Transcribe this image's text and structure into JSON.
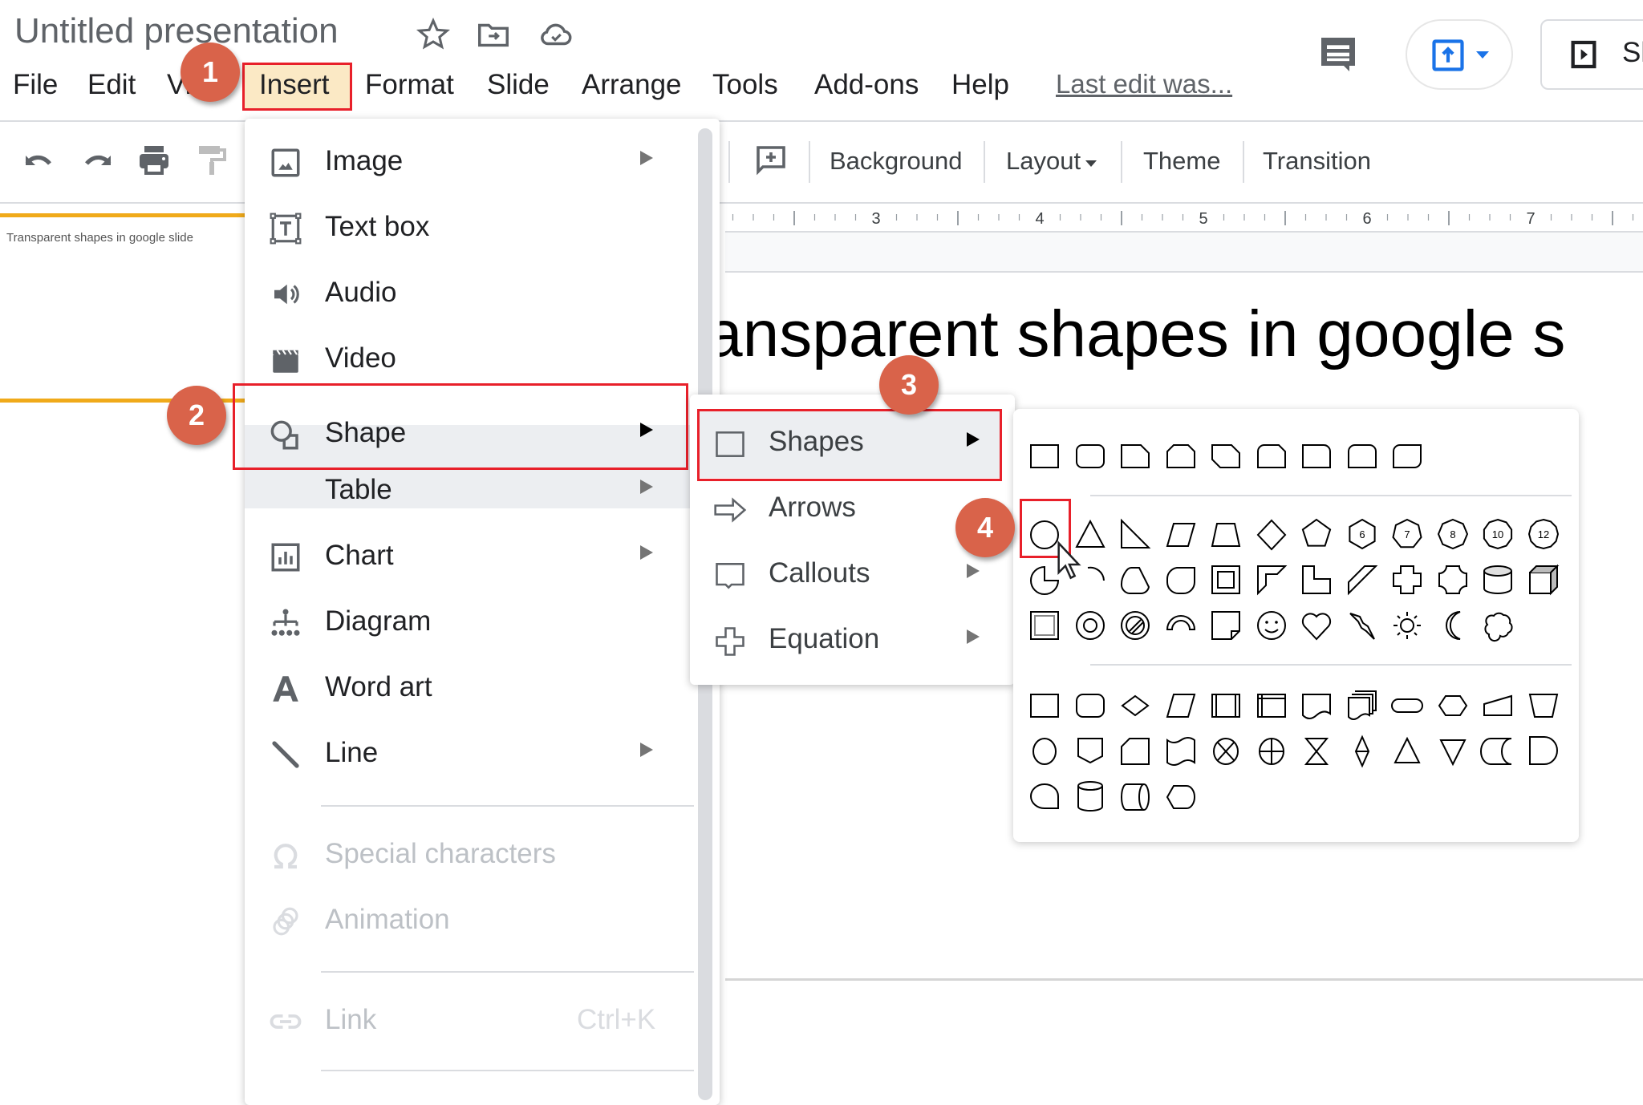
{
  "header": {
    "doc_title": "Untitled presentation",
    "icons": [
      "star-icon",
      "move-to-folder-icon",
      "cloud-saved-icon"
    ],
    "last_edit": "Last edit was...",
    "present_label": "Sl"
  },
  "menubar": {
    "items": [
      "File",
      "Edit",
      "View",
      "Insert",
      "Format",
      "Slide",
      "Arrange",
      "Tools",
      "Add-ons",
      "Help"
    ],
    "active": "Insert"
  },
  "toolbar": {
    "background": "Background",
    "layout": "Layout",
    "theme": "Theme",
    "transition": "Transition"
  },
  "ruler": {
    "labels": [
      "3",
      "4",
      "5",
      "6",
      "7"
    ]
  },
  "filmstrip": {
    "thumb_text": "Transparent shapes in google slide"
  },
  "slide": {
    "title": "ansparent shapes in google s"
  },
  "insert_menu": {
    "items": [
      {
        "label": "Image",
        "icon": "image-icon",
        "submenu": true,
        "disabled": false
      },
      {
        "label": "Text box",
        "icon": "text-box-icon",
        "submenu": false,
        "disabled": false
      },
      {
        "label": "Audio",
        "icon": "audio-icon",
        "submenu": false,
        "disabled": false
      },
      {
        "label": "Video",
        "icon": "video-icon",
        "submenu": false,
        "disabled": false
      },
      {
        "label": "Shape",
        "icon": "shape-icon",
        "submenu": true,
        "disabled": false,
        "highlighted": true
      },
      {
        "label": "Table",
        "icon": "",
        "submenu": true,
        "disabled": false
      },
      {
        "label": "Chart",
        "icon": "chart-icon",
        "submenu": true,
        "disabled": false
      },
      {
        "label": "Diagram",
        "icon": "diagram-icon",
        "submenu": false,
        "disabled": false
      },
      {
        "label": "Word art",
        "icon": "word-art-icon",
        "submenu": false,
        "disabled": false
      },
      {
        "label": "Line",
        "icon": "line-icon",
        "submenu": true,
        "disabled": false
      },
      {
        "label": "Special characters",
        "icon": "omega-icon",
        "submenu": false,
        "disabled": true
      },
      {
        "label": "Animation",
        "icon": "animation-icon",
        "submenu": false,
        "disabled": true
      },
      {
        "label": "Link",
        "icon": "link-icon",
        "submenu": false,
        "disabled": true,
        "shortcut": "Ctrl+K"
      }
    ]
  },
  "shape_menu": {
    "items": [
      {
        "label": "Shapes",
        "icon": "square-icon",
        "highlighted": true
      },
      {
        "label": "Arrows",
        "icon": "arrow-icon"
      },
      {
        "label": "Callouts",
        "icon": "callout-icon"
      },
      {
        "label": "Equation",
        "icon": "plus-icon"
      }
    ]
  },
  "palette": {
    "rectangles": [
      "rectangle",
      "rounded-rectangle",
      "snip-single-corner",
      "snip-same-side",
      "snip-diagonal",
      "snip-round-single",
      "round-single-corner",
      "round-same-side",
      "round-diagonal"
    ],
    "basic": [
      "oval",
      "triangle",
      "right-triangle",
      "parallelogram",
      "trapezoid",
      "diamond",
      "pentagon",
      "hexagon-6",
      "heptagon-7",
      "octagon-8",
      "decagon-10",
      "dodecagon-12",
      "pie",
      "chord-arc",
      "teardrop",
      "frame-round",
      "frame",
      "half-frame",
      "l-shape",
      "diagonal-stripe",
      "plus",
      "plaque",
      "can",
      "cube",
      "bevel",
      "donut",
      "no-symbol",
      "block-arc",
      "folded-corner",
      "smiley",
      "heart",
      "lightning",
      "sun",
      "moon",
      "cloud"
    ],
    "polygon_labels": [
      "6",
      "7",
      "8",
      "10",
      "12"
    ],
    "flowchart": [
      "process",
      "alternate-process",
      "decision",
      "data",
      "predefined-process",
      "internal-storage",
      "document",
      "multidocument",
      "terminator",
      "preparation",
      "manual-input",
      "manual-operation",
      "connector",
      "off-page-connector",
      "card",
      "punched-tape",
      "summing-junction",
      "or",
      "collate",
      "sort",
      "extract",
      "merge",
      "stored-data",
      "delay",
      "sequential-access",
      "magnetic-disk",
      "direct-access",
      "display"
    ],
    "selected": "oval"
  },
  "annotations": {
    "steps": [
      "1",
      "2",
      "3",
      "4"
    ],
    "highlight_color": "#e8202a",
    "badge_color": "#d9634a"
  }
}
